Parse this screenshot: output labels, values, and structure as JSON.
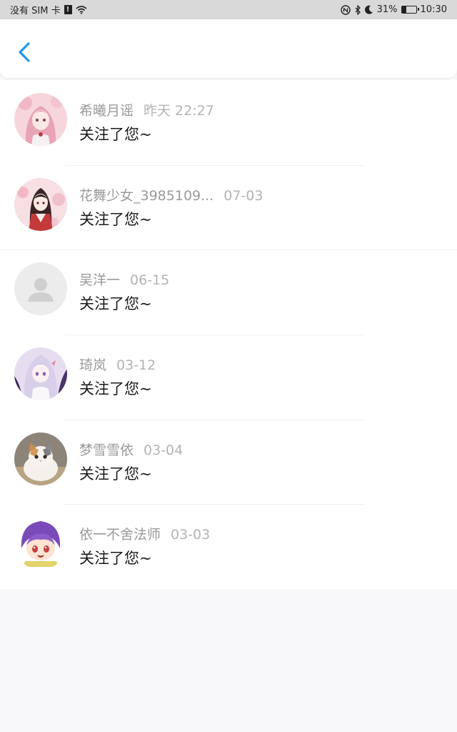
{
  "status_bar": {
    "carrier": "没有 SIM 卡",
    "sim_alert": "!",
    "battery_percent": "31%",
    "battery_level": 0.31,
    "time": "10:30",
    "icons": [
      "wifi-icon",
      "nfc-icon",
      "bluetooth-icon",
      "moon-icon",
      "battery-icon"
    ]
  },
  "header": {
    "back_icon": "chevron-left-icon",
    "accent": "#2196f3"
  },
  "notifications": [
    {
      "name": "希曦月谣",
      "time": "昨天 22:27",
      "message": "关注了您~",
      "avatar": "anime-pink-girl"
    },
    {
      "name": "花舞少女_3985109...",
      "time": "07-03",
      "message": "关注了您~",
      "avatar": "anime-kimono-girl"
    },
    {
      "name": "吴洋一",
      "time": "06-15",
      "message": "关注了您~",
      "avatar": "default-person"
    },
    {
      "name": "琦岚",
      "time": "03-12",
      "message": "关注了您~",
      "avatar": "anime-lilac-girl"
    },
    {
      "name": "梦雪雪依",
      "time": "03-04",
      "message": "关注了您~",
      "avatar": "kitten"
    },
    {
      "name": "依一不舍法师",
      "time": "03-03",
      "message": "关注了您~",
      "avatar": "chibi-purple-hair"
    }
  ]
}
